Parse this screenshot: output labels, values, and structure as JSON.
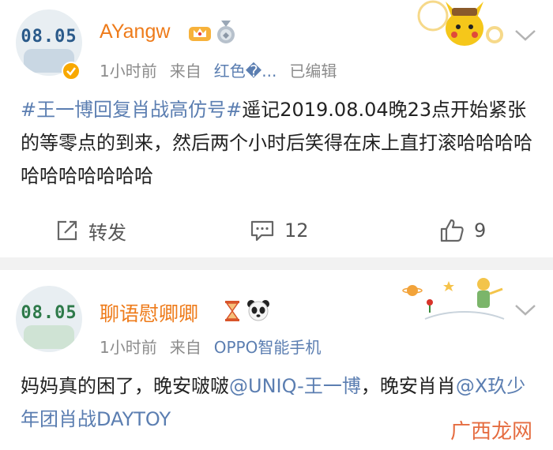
{
  "posts": [
    {
      "username": "AYangw",
      "avatar_text": "08.05",
      "time": "1小时前",
      "source_prefix": "来自",
      "source": "红色�...",
      "edited": "已编辑",
      "hashtag": "#王一博回复肖战高仿号#",
      "text": "遥记2019.08.04晚23点开始紧张的等零点的到来，然后两个小时后笑得在床上直打滚哈哈哈哈哈哈哈哈哈哈哈",
      "repost_label": "转发",
      "comment_count": "12",
      "like_count": "9"
    },
    {
      "username": "聊语慰卿卿",
      "avatar_text": "08.05",
      "time": "1小时前",
      "source_prefix": "来自",
      "source": "OPPO智能手机",
      "text_part1": "妈妈真的困了，晚安啵啵",
      "mention1": "@UNIQ-王一博",
      "text_part2": "，晚安肖肖",
      "mention2": "@X玖少年团肖战DAYTOY"
    }
  ],
  "watermark": "广西龙网",
  "colors": {
    "username": "#ee7b1a",
    "link": "#5b7eb1",
    "meta": "#8c8c8c",
    "separator": "#f2f2f2"
  },
  "icons": [
    "verified-icon",
    "crown-icon",
    "medal-icon",
    "hourglass-icon",
    "panda-icon",
    "chevron-down-icon",
    "repost-icon",
    "comment-icon",
    "like-icon"
  ]
}
